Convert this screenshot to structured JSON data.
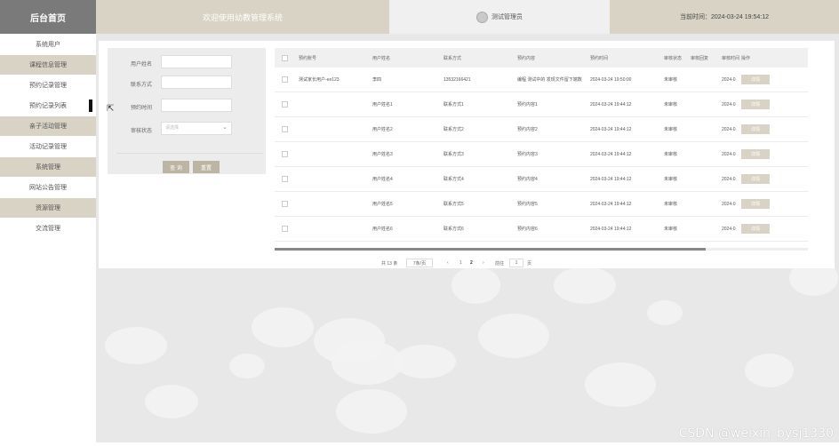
{
  "header": {
    "logo": "后台首页",
    "welcome": "欢迎使用幼教管理系统",
    "admin_name": "测试管理员",
    "time_text": "当前时间：2024-03-24 19:54:12"
  },
  "sidebar": {
    "items": [
      {
        "label": "系统用户"
      },
      {
        "label": "课程信息管理"
      },
      {
        "label": "预约记录管理"
      },
      {
        "label": "预约记录列表"
      },
      {
        "label": "亲子活动管理"
      },
      {
        "label": "活动记录管理"
      },
      {
        "label": "系统管理"
      },
      {
        "label": "网站公告管理"
      },
      {
        "label": "资源管理"
      },
      {
        "label": "交流管理"
      }
    ]
  },
  "form": {
    "fields": [
      {
        "label": "用户姓名",
        "placeholder": ""
      },
      {
        "label": "联系方式",
        "placeholder": ""
      },
      {
        "label": "预约时间",
        "placeholder": ""
      },
      {
        "label": "审核状态",
        "placeholder": "请选择"
      }
    ],
    "search_label": "查 询",
    "reset_label": "重置"
  },
  "table": {
    "headers": [
      "预约账号",
      "用户姓名",
      "联系方式",
      "预约内容",
      "预约时间",
      "审核状态",
      "审核回复",
      "审核时间",
      "操作"
    ],
    "rows": [
      {
        "account": "测试家长用户-ee123",
        "name": "李四",
        "phone": "13532166421",
        "content": "编程 测试中的 发现文件留下端数",
        "time": "2024-03-24 19:50:00",
        "status": "未审核",
        "reply": "",
        "audit_time": "2024-0",
        "action": "详情"
      },
      {
        "account": "",
        "name": "用户姓名1",
        "phone": "联系方式1",
        "content": "预约内容1",
        "time": "2024-03-24 19:44:12",
        "status": "未审核",
        "reply": "",
        "audit_time": "2024-0",
        "action": "详情"
      },
      {
        "account": "",
        "name": "用户姓名2",
        "phone": "联系方式2",
        "content": "预约内容2",
        "time": "2024-03-24 19:44:12",
        "status": "未审核",
        "reply": "",
        "audit_time": "2024-0",
        "action": "详情"
      },
      {
        "account": "",
        "name": "用户姓名3",
        "phone": "联系方式3",
        "content": "预约内容3",
        "time": "2024-03-24 19:44:12",
        "status": "未审核",
        "reply": "",
        "audit_time": "2024-0",
        "action": "详情"
      },
      {
        "account": "",
        "name": "用户姓名4",
        "phone": "联系方式4",
        "content": "预约内容4",
        "time": "2024-03-24 19:44:12",
        "status": "未审核",
        "reply": "",
        "audit_time": "2024-0",
        "action": "详情"
      },
      {
        "account": "",
        "name": "用户姓名5",
        "phone": "联系方式5",
        "content": "预约内容5",
        "time": "2024-03-24 19:44:12",
        "status": "未审核",
        "reply": "",
        "audit_time": "2024-0",
        "action": "详情"
      },
      {
        "account": "",
        "name": "用户姓名6",
        "phone": "联系方式6",
        "content": "预约内容6",
        "time": "2024-03-24 19:44:12",
        "status": "未审核",
        "reply": "",
        "audit_time": "2024-0",
        "action": "详情"
      }
    ]
  },
  "pager": {
    "total": "共 13 条",
    "page_size": "7条/页",
    "prev": "‹",
    "page1": "1",
    "page2": "2",
    "next": "›",
    "goto_label": "前往",
    "goto_value": "1",
    "page_unit": "页"
  },
  "watermark": "CSDN @weixin_bysj1330",
  "colors": {
    "accent": "#d8d3c4",
    "logo_bg": "#7a7a7a",
    "button": "#bdb5a3",
    "main_bg": "#e8e8e8"
  }
}
